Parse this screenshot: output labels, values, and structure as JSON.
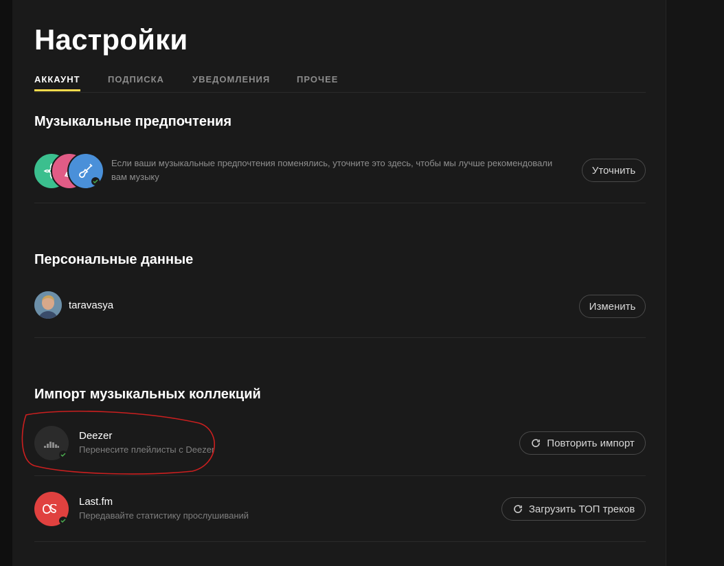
{
  "page": {
    "title": "Настройки"
  },
  "tabs": [
    {
      "label": "АККАУНТ",
      "active": true
    },
    {
      "label": "ПОДПИСКА",
      "active": false
    },
    {
      "label": "УВЕДОМЛЕНИЯ",
      "active": false
    },
    {
      "label": "ПРОЧЕЕ",
      "active": false
    }
  ],
  "preferences": {
    "title": "Музыкальные предпочтения",
    "text": "Если ваши музыкальные предпочтения поменялись, уточните это здесь, чтобы мы лучше рекомендовали вам музыку",
    "button": "Уточнить",
    "genre_icons": [
      "flower-icon",
      "guitar-icon",
      "electric-guitar-icon"
    ]
  },
  "personal": {
    "title": "Персональные данные",
    "username": "taravasya",
    "button": "Изменить"
  },
  "import": {
    "title": "Импорт музыкальных коллекций",
    "services": [
      {
        "name": "Deezer",
        "description": "Перенесите плейлисты с Deezer",
        "button": "Повторить импорт",
        "icon": "deezer-icon",
        "color": "#2b2b2b"
      },
      {
        "name": "Last.fm",
        "description": "Передавайте статистику прослушиваний",
        "button": "Загрузить ТОП треков",
        "icon": "lastfm-icon",
        "color": "#e0413f"
      }
    ]
  },
  "colors": {
    "accent": "#ffdb4d",
    "check": "#4caf50",
    "annotation": "#cc1f1f"
  }
}
